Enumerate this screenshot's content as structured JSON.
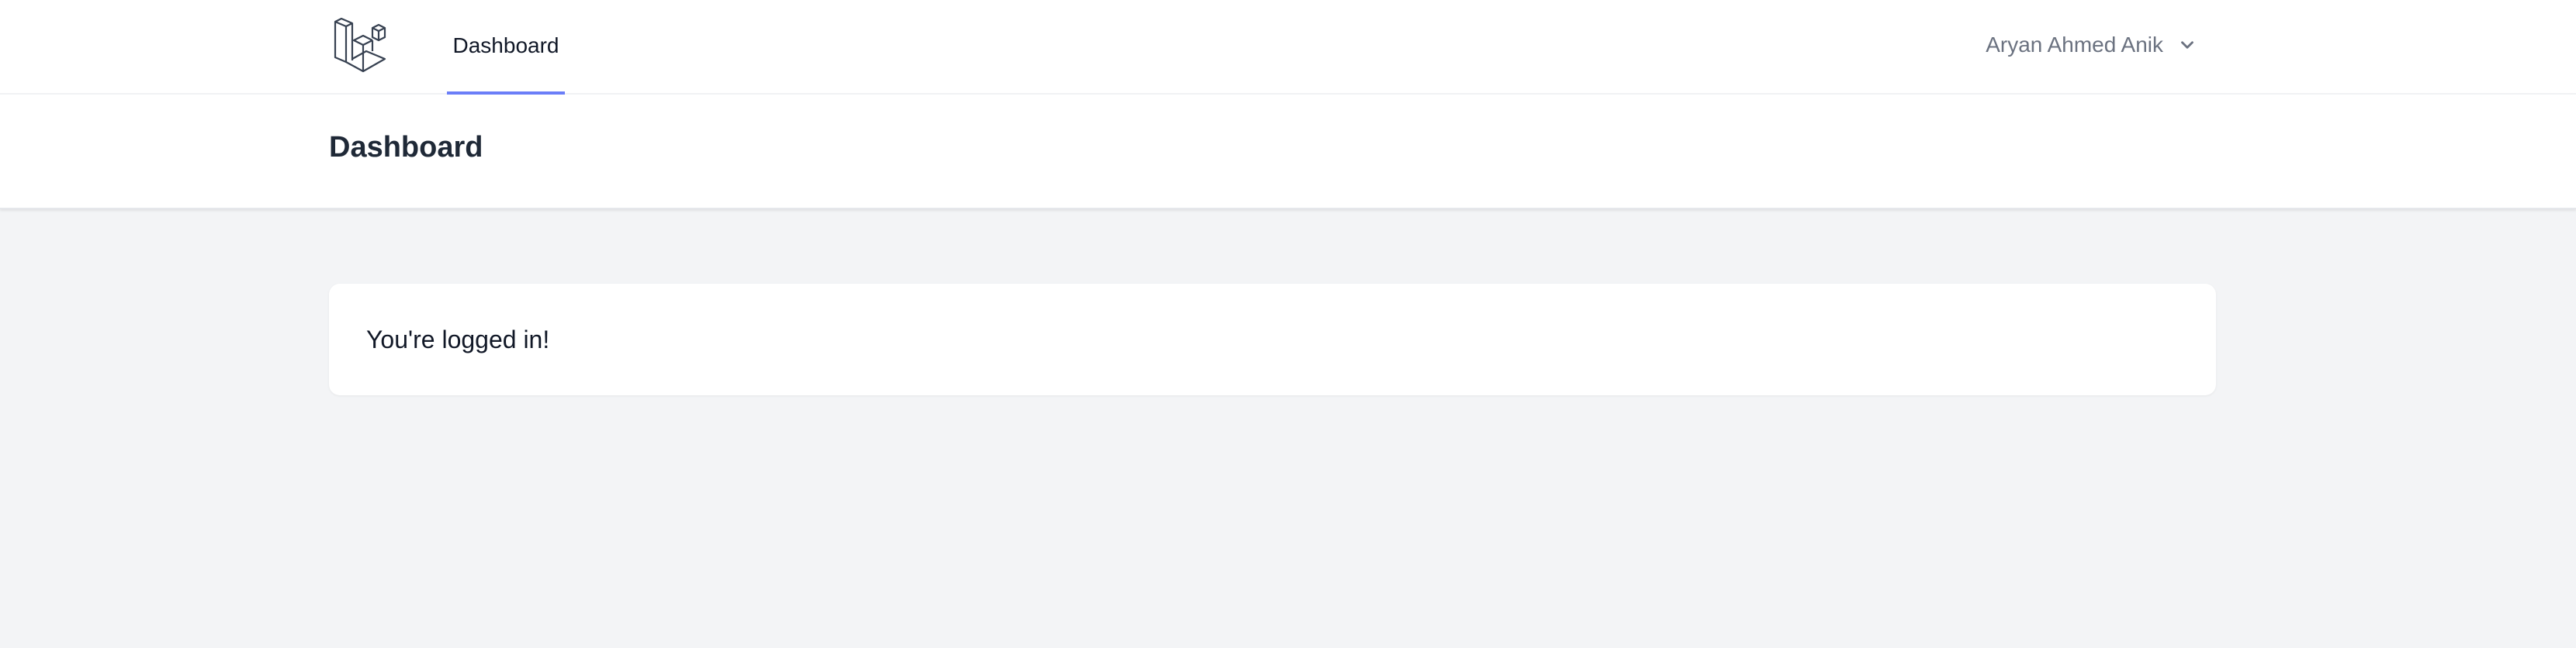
{
  "nav": {
    "logo_icon": "laravel-logo-icon",
    "links": [
      {
        "label": "Dashboard",
        "active": true
      }
    ],
    "user": {
      "name": "Aryan Ahmed Anik",
      "icon": "chevron-down-icon"
    },
    "accent_color": "#6b7ef8"
  },
  "header": {
    "title": "Dashboard"
  },
  "main": {
    "message": "You're logged in!"
  }
}
